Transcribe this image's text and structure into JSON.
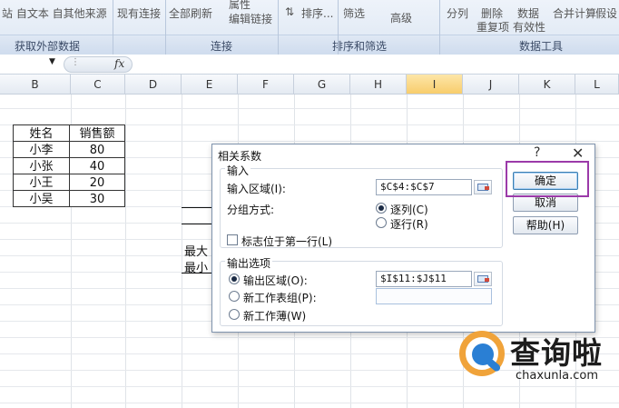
{
  "ribbon": {
    "top_items": [
      "站 自文本 自其他来源",
      "现有连接",
      "全部刷新",
      "属性",
      "编辑链接",
      "排序...",
      "筛选",
      "高级",
      "分列",
      "删除",
      "数据",
      "合并计算",
      "假设"
    ],
    "sub_items": [
      "重复项",
      "有效性"
    ],
    "groups": [
      "获取外部数据",
      "连接",
      "排序和筛选",
      "数据工具"
    ]
  },
  "formula_bar": {
    "name_box": "",
    "fx_label": "fx"
  },
  "columns": [
    "B",
    "C",
    "D",
    "E",
    "F",
    "G",
    "H",
    "I",
    "J",
    "K",
    "L"
  ],
  "selected_column": "I",
  "table": {
    "headers": [
      "姓名",
      "销售额"
    ],
    "rows": [
      [
        "小李",
        "80"
      ],
      [
        "小张",
        "40"
      ],
      [
        "小王",
        "20"
      ],
      [
        "小吴",
        "30"
      ]
    ]
  },
  "sheet_labels": [
    "最大",
    "最小"
  ],
  "dialog": {
    "title": "相关系数",
    "help": "?",
    "close": "✕",
    "input_group": "输入",
    "input_range_label": "输入区域(I):",
    "input_range_value": "$C$4:$C$7",
    "group_by_label": "分组方式:",
    "by_column": "逐列(C)",
    "by_row": "逐行(R)",
    "labels_first_row": "标志位于第一行(L)",
    "output_group": "输出选项",
    "output_range_label": "输出区域(O):",
    "output_range_value": "$I$11:$J$11",
    "new_sheet_label": "新工作表组(P):",
    "new_workbook_label": "新工作薄(W)",
    "ok": "确定",
    "cancel": "取消",
    "help_button": "帮助(H)"
  },
  "watermark": {
    "name": "查询啦",
    "url": "chaxunla.com"
  }
}
